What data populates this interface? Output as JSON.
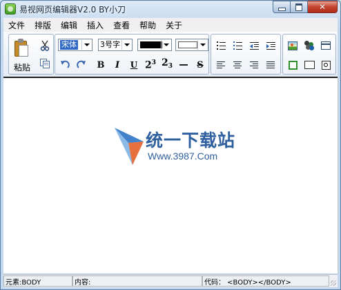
{
  "window": {
    "title": "易视网页编辑器V2.0 BY小刀",
    "controls": {
      "minimize": "",
      "maximize": "",
      "close": "✕"
    }
  },
  "menu": [
    "文件",
    "排版",
    "编辑",
    "插入",
    "查看",
    "帮助",
    "关于"
  ],
  "toolbar": {
    "paste_label": "粘贴",
    "font_family": "宋体",
    "font_size": "3号字",
    "fore_color": "#000000",
    "back_color": "#ffffff",
    "bold": "B",
    "italic": "I",
    "underline": "U",
    "superscript": {
      "base": "2",
      "script": "3"
    },
    "subscript": {
      "base": "2",
      "script": "3"
    },
    "strikethrough": "S"
  },
  "editor": {
    "watermark_title": "统一下载站",
    "watermark_url": "Www.3987.Com"
  },
  "status": {
    "element": "元素:BODY",
    "content": "内容:",
    "code": "代码：  <BODY></BODY>"
  },
  "colors": {
    "titlebar": "#c3d8ee",
    "selection": "#316ac5",
    "watermark": "#2e5f9e",
    "close_button": "#c4442f"
  },
  "icons": [
    "app-icon",
    "paste-icon",
    "cut-icon",
    "copy-icon",
    "undo-icon",
    "redo-icon",
    "numbered-list-icon",
    "bullet-list-icon",
    "outdent-icon",
    "indent-icon",
    "align-left-icon",
    "align-center-icon",
    "align-right-icon",
    "align-justify-icon",
    "insert-image-icon",
    "insert-media-icon",
    "insert-table-icon",
    "insert-frame-icon",
    "insert-textbox-icon",
    "insert-radio-icon"
  ]
}
